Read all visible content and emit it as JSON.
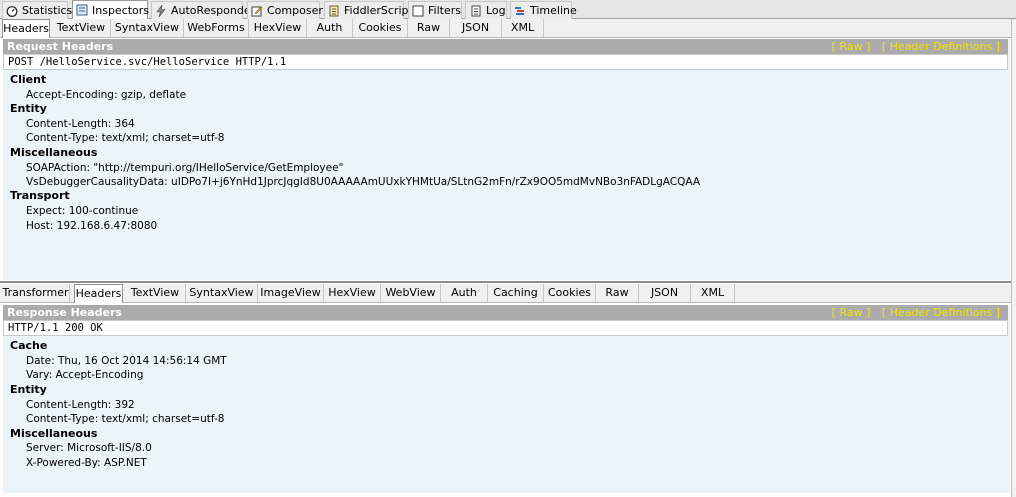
{
  "top_tabs": [
    {
      "label": "Statistics",
      "icon": "stopwatch-icon",
      "active": false
    },
    {
      "label": "Inspectors",
      "icon": "inspectors-icon",
      "active": true
    },
    {
      "label": "AutoResponder",
      "icon": "lightning-icon",
      "active": false
    },
    {
      "label": "Composer",
      "icon": "composer-icon",
      "active": false
    },
    {
      "label": "FiddlerScript",
      "icon": "script-icon",
      "active": false
    },
    {
      "label": "Filters",
      "icon": "checkbox-icon",
      "active": false
    },
    {
      "label": "Log",
      "icon": "log-icon",
      "active": false
    },
    {
      "label": "Timeline",
      "icon": "timeline-icon",
      "active": false
    }
  ],
  "request": {
    "tabs": [
      "Headers",
      "TextView",
      "SyntaxView",
      "WebForms",
      "HexView",
      "Auth",
      "Cookies",
      "Raw",
      "JSON",
      "XML"
    ],
    "active_tab": "Headers",
    "title": "Request Headers",
    "raw_link": "[ Raw ]",
    "defs_link": "[ Header Definitions ]",
    "first_line": "POST /HelloService.svc/HelloService HTTP/1.1",
    "groups": [
      {
        "name": "Client",
        "headers": [
          "Accept-Encoding: gzip, deflate"
        ]
      },
      {
        "name": "Entity",
        "headers": [
          "Content-Length: 364",
          "Content-Type: text/xml; charset=utf-8"
        ]
      },
      {
        "name": "Miscellaneous",
        "headers": [
          "SOAPAction: \"http://tempuri.org/IHelloService/GetEmployee\"",
          "VsDebuggerCausalityData: uIDPo7I+j6YnHd1JprcJqgId8U0AAAAAmUUxkYHMtUa/SLtnG2mFn/rZx9OO5mdMvNBo3nFADLgACQAA"
        ]
      },
      {
        "name": "Transport",
        "headers": [
          "Expect: 100-continue",
          "Host: 192.168.6.47:8080"
        ]
      }
    ]
  },
  "response": {
    "tabs": [
      "Transformer",
      "Headers",
      "TextView",
      "SyntaxView",
      "ImageView",
      "HexView",
      "WebView",
      "Auth",
      "Caching",
      "Cookies",
      "Raw",
      "JSON",
      "XML"
    ],
    "active_tab": "Headers",
    "title": "Response Headers",
    "raw_link": "[ Raw ]",
    "defs_link": "[ Header Definitions ]",
    "first_line": "HTTP/1.1 200 OK",
    "groups": [
      {
        "name": "Cache",
        "headers": [
          "Date: Thu, 16 Oct 2014 14:56:14 GMT",
          "Vary: Accept-Encoding"
        ]
      },
      {
        "name": "Entity",
        "headers": [
          "Content-Length: 392",
          "Content-Type: text/xml; charset=utf-8"
        ]
      },
      {
        "name": "Miscellaneous",
        "headers": [
          "Server: Microsoft-IIS/8.0",
          "X-Powered-By: ASP.NET"
        ]
      }
    ]
  },
  "colors": {
    "pane_background": "#eaf4f9",
    "title_bar": "#ababab",
    "link_yellow": "#f5e300"
  }
}
